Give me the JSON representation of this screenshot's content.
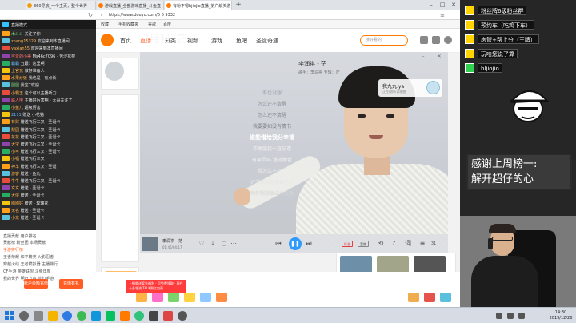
{
  "browser": {
    "tabs": [
      {
        "label": "360导航_一个主页，整个世界",
        "active": false
      },
      {
        "label": "游戏直播_全部游戏直播_斗鱼直",
        "active": false
      },
      {
        "label": "有粉不嗯bjiojio直播_第户解美游",
        "active": true
      }
    ],
    "url": "https://www.douyu.com/6 6 9332   ",
    "bookmarks": [
      "收藏",
      "手机收藏夹",
      "谷歌",
      "百度",
      "直播导航"
    ],
    "nav": {
      "home": "首页",
      "live": "直播",
      "category": "分类",
      "video": "视频",
      "game": "游戏",
      "fishbar": "鱼吧",
      "esports": "圣诞奇遇",
      "search_placeholder": "搜好看的"
    }
  },
  "overlay_text": "3月1日芷",
  "chat": {
    "header": "直播模式",
    "messages": [
      {
        "nick": "木斗斗",
        "text": "关注了你",
        "color": "g"
      },
      {
        "nick": "zhang15329",
        "text": "欢迎来到本直播间",
        "color": ""
      },
      {
        "nick": "yaxian55",
        "text": "欢迎来到本直播间",
        "color": ""
      },
      {
        "nick": "可爱的小美",
        "text": "Ms46c7096 · 苦涩花楼",
        "color": "r"
      },
      {
        "nick": "霸霸",
        "text": "丑跟：这里啊",
        "color": "b"
      },
      {
        "nick": "上官瓦",
        "text": "做好准备人",
        "color": ""
      },
      {
        "nick": "水果炒饭",
        "text": "我也是 · 有点长",
        "color": ""
      },
      {
        "nick": "圆圆",
        "text": "我宝7欢迎",
        "color": "g"
      },
      {
        "nick": "小霸王",
        "text": "这个可以主播听力",
        "color": ""
      },
      {
        "nick": "路人甲",
        "text": "主播好厉害啊 · 大哥关注了",
        "color": "r"
      },
      {
        "nick": "小鱼儿",
        "text": "超级厉害",
        "color": ""
      },
      {
        "nick": "2111",
        "text": "赠送 小花猫",
        "color": "b"
      },
      {
        "nick": "有财",
        "text": "赠送飞行三叉 · 圣诞卡",
        "color": ""
      },
      {
        "nick": "梨园",
        "text": "赠送飞行三叉 · 圣诞卡",
        "color": ""
      },
      {
        "nick": "花花",
        "text": "赠送飞行三叉 · 圣诞卡",
        "color": ""
      },
      {
        "nick": "大宝",
        "text": "赠送飞行三叉 · 圣诞卡",
        "color": ""
      },
      {
        "nick": "小可",
        "text": "赠送飞行三叉 · 圣诞卡",
        "color": ""
      },
      {
        "nick": "小福",
        "text": "赠送飞行三叉",
        "color": ""
      },
      {
        "nick": "神羊",
        "text": "赠送飞行三叉 · 圣诞",
        "color": ""
      },
      {
        "nick": "游客",
        "text": "赠送 · 鱼丸",
        "color": ""
      },
      {
        "nick": "牛牛",
        "text": "赠送飞行三叉 · 圣诞卡",
        "color": ""
      },
      {
        "nick": "玄玄",
        "text": "赠送 · 圣诞卡",
        "color": ""
      },
      {
        "nick": "大侠",
        "text": "赠送 · 圣诞卡",
        "color": ""
      },
      {
        "nick": "刚刚好",
        "text": "赠送 · 玫瑰花",
        "color": ""
      },
      {
        "nick": "无名",
        "text": "赠送 · 圣诞卡",
        "color": ""
      },
      {
        "nick": "小龙",
        "text": "赠送 · 圣诞卡",
        "color": ""
      }
    ],
    "panel_rows": [
      "直播贡献  用户排名",
      "贡献榜  粉丝团  本场贡献",
      "手游排行榜",
      "王者荣耀  和平精英  火影忍者",
      "穿越火线  王者模拟器  主播排行",
      "CF手游  英雄联盟  斗鱼年度",
      "我的世界  明日方舟  梦幻手游"
    ],
    "gift_buttons": [
      "账户余额充值",
      "充值有礼"
    ]
  },
  "player": {
    "song_title": "李润祺 - 茫",
    "song_sub": "歌手：李润祺   专辑：茫",
    "lyrics": [
      {
        "text": "谁也没想",
        "state": "past"
      },
      {
        "text": "怎么还不清醒",
        "state": "past"
      },
      {
        "text": "怎么还不清醒",
        "state": "past"
      },
      {
        "text": "我要要如没有情书",
        "state": "past"
      },
      {
        "text": "谁能借给我分幸福",
        "state": "current"
      },
      {
        "text": "不敢强我一直忘透",
        "state": "future"
      },
      {
        "text": "有原因吗 迷成静音",
        "state": "future"
      },
      {
        "text": "我怎么不行心",
        "state": "future"
      },
      {
        "text": "好学歌曲见来自己好",
        "state": "future"
      },
      {
        "text": "和你想想象出个成功",
        "state": "future"
      }
    ],
    "user_name": "我九九.ya",
    "user_sub": "正在/收听该歌曲",
    "now_playing": "李润祺 - 茫",
    "time": "01:46/04:17",
    "quality": "标准",
    "quality2": "音效",
    "count": "31"
  },
  "right_panel": {
    "goals": [
      {
        "text": "粉丝牌6级粉丝群",
        "color": "yellow"
      },
      {
        "text": "预约车（吃鸡下车）",
        "color": "yellow"
      },
      {
        "text": "房管+帮上分（王牌）",
        "color": "yellow"
      },
      {
        "text": "玩啥您说了算",
        "color": "yellow"
      },
      {
        "text": "bljiojio",
        "color": "green"
      }
    ],
    "thanks_line1": "感谢上周榜一:",
    "thanks_line2": "解开超仔的心"
  },
  "page": {
    "promo": "上播就送奖金福利 · 可免费领取 · 现在十多领流 TALK到红包雨"
  },
  "taskbar": {
    "time": "14:30",
    "date": "2019/12/26"
  }
}
